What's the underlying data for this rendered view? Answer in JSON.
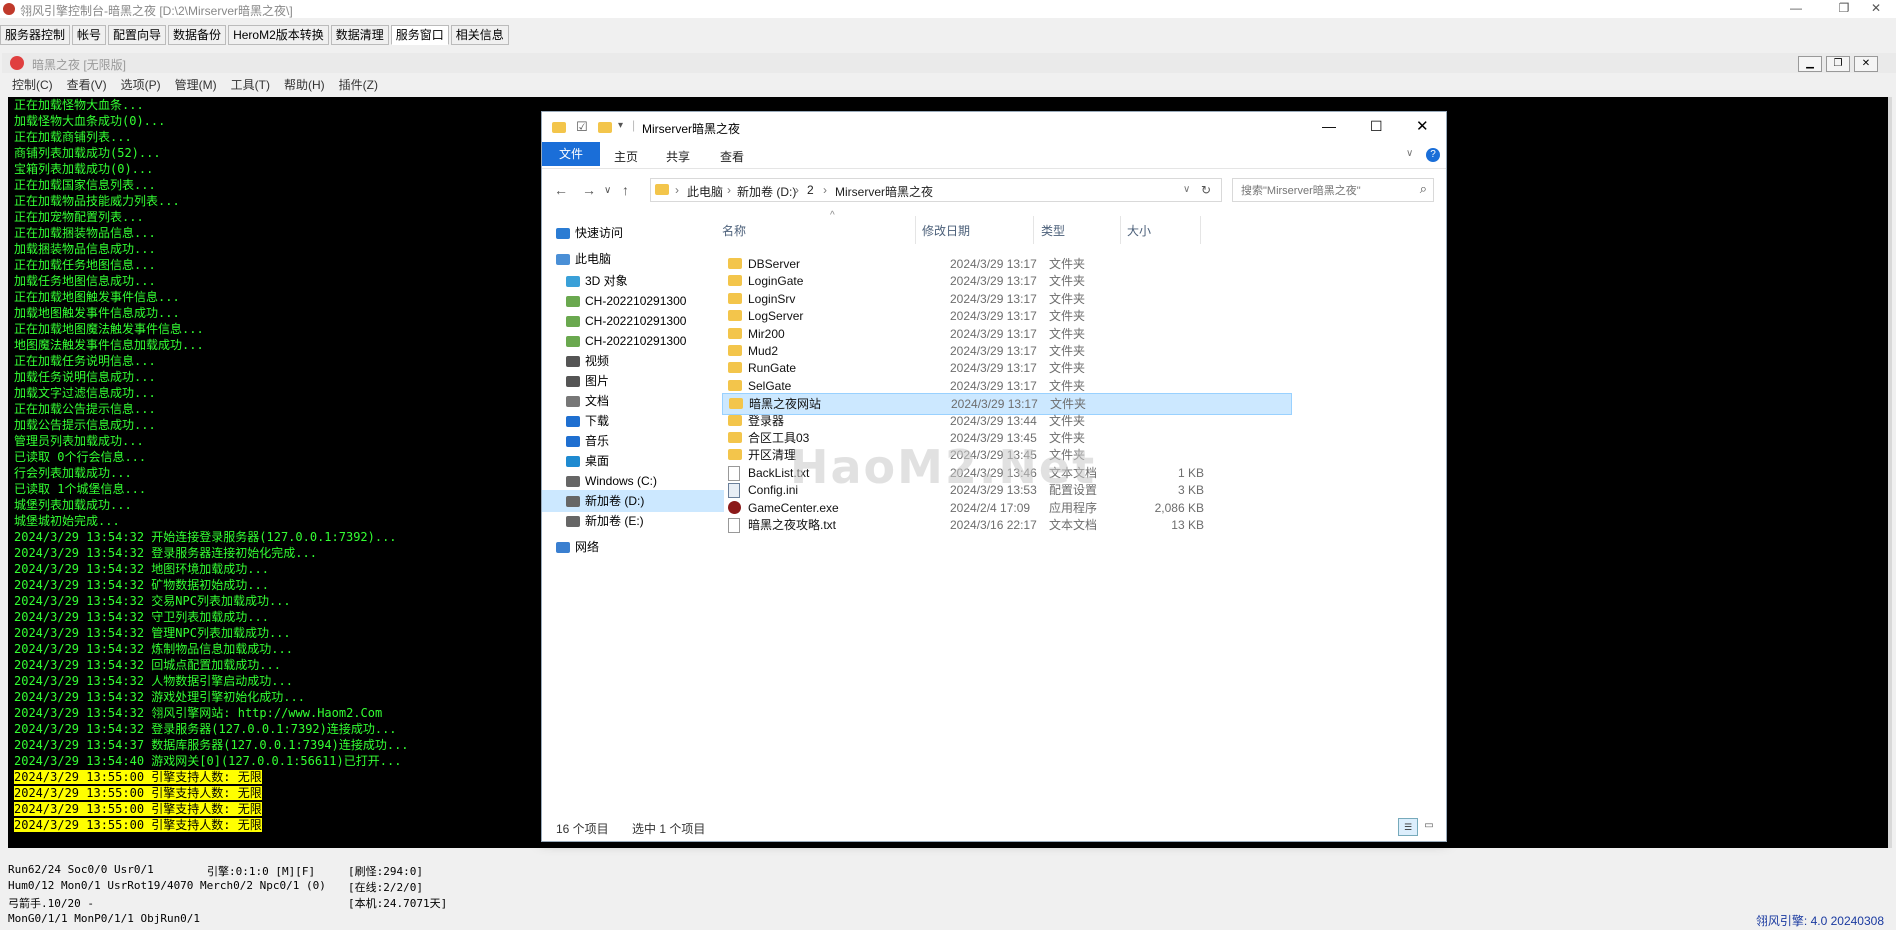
{
  "app": {
    "title": "翎风引擎控制台-暗黑之夜 [D:\\2\\Mirserver暗黑之夜\\]",
    "tabs": [
      "服务器控制",
      "帐号",
      "配置向导",
      "数据备份",
      "HeroM2版本转换",
      "数据清理",
      "服务窗口",
      "相关信息"
    ],
    "active_tab": "服务窗口"
  },
  "mdi": {
    "title": "暗黑之夜 [无限版]",
    "menu": [
      "控制(C)",
      "查看(V)",
      "选项(P)",
      "管理(M)",
      "工具(T)",
      "帮助(H)",
      "插件(Z)"
    ]
  },
  "console": {
    "lines": [
      "正在加载怪物大血条...",
      "加载怪物大血条成功(0)...",
      "正在加载商铺列表...",
      "商铺列表加载成功(52)...",
      "宝箱列表加载成功(0)...",
      "正在加载国家信息列表...",
      "正在加载物品技能威力列表...",
      "正在加宠物配置列表...",
      "正在加载捆装物品信息...",
      "加载捆装物品信息成功...",
      "正在加载任务地图信息...",
      "加载任务地图信息成功...",
      "正在加载地图触发事件信息...",
      "加载地图触发事件信息成功...",
      "正在加载地图魔法触发事件信息...",
      "地图魔法触发事件信息加载成功...",
      "正在加载任务说明信息...",
      "加载任务说明信息成功...",
      "加载文字过滤信息成功...",
      "正在加载公告提示信息...",
      "加载公告提示信息成功...",
      "管理员列表加载成功...",
      "已读取 0个行会信息...",
      "行会列表加载成功...",
      "已读取 1个城堡信息...",
      "城堡列表加载成功...",
      "城堡城初始完成...",
      "2024/3/29 13:54:32 开始连接登录服务器(127.0.0.1:7392)...",
      "2024/3/29 13:54:32 登录服务器连接初始化完成...",
      "2024/3/29 13:54:32 地图环境加载成功...",
      "2024/3/29 13:54:32 矿物数据初始成功...",
      "2024/3/29 13:54:32 交易NPC列表加载成功...",
      "2024/3/29 13:54:32 守卫列表加载成功...",
      "2024/3/29 13:54:32 管理NPC列表加载成功...",
      "2024/3/29 13:54:32 炼制物品信息加载成功...",
      "2024/3/29 13:54:32 回城点配置加载成功...",
      "2024/3/29 13:54:32 人物数据引擎启动成功...",
      "2024/3/29 13:54:32 游戏处理引擎初始化成功...",
      "2024/3/29 13:54:32 翎风引擎网站: http://www.Haom2.Com",
      "2024/3/29 13:54:32 登录服务器(127.0.0.1:7392)连接成功...",
      "2024/3/29 13:54:37 数据库服务器(127.0.0.1:7394)连接成功...",
      "2024/3/29 13:54:40 游戏网关[0](127.0.0.1:56611)已打开..."
    ],
    "highlight_lines": [
      "2024/3/29 13:55:00 引擎支持人数: 无限",
      "2024/3/29 13:55:00 引擎支持人数: 无限",
      "2024/3/29 13:55:00 引擎支持人数: 无限",
      "2024/3/29 13:55:00 引擎支持人数: 无限"
    ]
  },
  "status": {
    "col1": [
      "Run62/24 Soc0/0 Usr0/1",
      "Hum0/12 Mon0/1 UsrRot19/4070 Merch0/2 Npc0/1 (0)",
      "弓箭手.10/20 -",
      "MonG0/1/1 MonP0/1/1 ObjRun0/1"
    ],
    "engine": "引擎:0:1:0 [M][F]",
    "col3": [
      "[刷怪:294:0]",
      "[在线:2/2/0]",
      "[本机:24.7071天]"
    ],
    "version": "翎风引擎: 4.0 20240308"
  },
  "explorer": {
    "title": "Mirserver暗黑之夜",
    "ribbon": {
      "file": "文件",
      "home": "主页",
      "share": "共享",
      "view": "查看"
    },
    "breadcrumb": [
      "此电脑",
      "新加卷 (D:)",
      "2",
      "Mirserver暗黑之夜"
    ],
    "search_placeholder": "搜索\"Mirserver暗黑之夜\"",
    "nav": [
      {
        "label": "快速访问",
        "icon": "star-icon",
        "color": "#2b7cd3"
      },
      {
        "label": "此电脑",
        "icon": "computer-icon",
        "color": "#4a8fd6"
      },
      {
        "label": "3D 对象",
        "icon": "cube-icon",
        "color": "#3aa0d8"
      },
      {
        "label": "CH-202210291300",
        "icon": "network-drive-icon",
        "color": "#6aa84f"
      },
      {
        "label": "CH-202210291300",
        "icon": "network-drive-icon",
        "color": "#6aa84f"
      },
      {
        "label": "CH-202210291300",
        "icon": "network-drive-icon",
        "color": "#6aa84f"
      },
      {
        "label": "视频",
        "icon": "video-icon",
        "color": "#555555"
      },
      {
        "label": "图片",
        "icon": "pictures-icon",
        "color": "#555555"
      },
      {
        "label": "文档",
        "icon": "documents-icon",
        "color": "#777777"
      },
      {
        "label": "下载",
        "icon": "download-icon",
        "color": "#1f6fd0"
      },
      {
        "label": "音乐",
        "icon": "music-icon",
        "color": "#1f6fd0"
      },
      {
        "label": "桌面",
        "icon": "desktop-icon",
        "color": "#1f8ad0"
      },
      {
        "label": "Windows (C:)",
        "icon": "drive-icon",
        "color": "#666666"
      },
      {
        "label": "新加卷 (D:)",
        "icon": "drive-icon",
        "color": "#666666"
      },
      {
        "label": "新加卷 (E:)",
        "icon": "drive-icon",
        "color": "#666666"
      },
      {
        "label": "网络",
        "icon": "network-icon",
        "color": "#3a7fd0"
      }
    ],
    "nav_selected_index": 13,
    "columns": {
      "name": "名称",
      "date": "修改日期",
      "type": "类型",
      "size": "大小"
    },
    "files": [
      {
        "name": "DBServer",
        "date": "2024/3/29 13:17",
        "type": "文件夹",
        "size": "",
        "kind": "folder"
      },
      {
        "name": "LoginGate",
        "date": "2024/3/29 13:17",
        "type": "文件夹",
        "size": "",
        "kind": "folder"
      },
      {
        "name": "LoginSrv",
        "date": "2024/3/29 13:17",
        "type": "文件夹",
        "size": "",
        "kind": "folder"
      },
      {
        "name": "LogServer",
        "date": "2024/3/29 13:17",
        "type": "文件夹",
        "size": "",
        "kind": "folder"
      },
      {
        "name": "Mir200",
        "date": "2024/3/29 13:17",
        "type": "文件夹",
        "size": "",
        "kind": "folder"
      },
      {
        "name": "Mud2",
        "date": "2024/3/29 13:17",
        "type": "文件夹",
        "size": "",
        "kind": "folder"
      },
      {
        "name": "RunGate",
        "date": "2024/3/29 13:17",
        "type": "文件夹",
        "size": "",
        "kind": "folder"
      },
      {
        "name": "SelGate",
        "date": "2024/3/29 13:17",
        "type": "文件夹",
        "size": "",
        "kind": "folder"
      },
      {
        "name": "暗黑之夜网站",
        "date": "2024/3/29 13:17",
        "type": "文件夹",
        "size": "",
        "kind": "folder"
      },
      {
        "name": "登录器",
        "date": "2024/3/29 13:44",
        "type": "文件夹",
        "size": "",
        "kind": "folder"
      },
      {
        "name": "合区工具03",
        "date": "2024/3/29 13:45",
        "type": "文件夹",
        "size": "",
        "kind": "folder"
      },
      {
        "name": "开区清理",
        "date": "2024/3/29 13:45",
        "type": "文件夹",
        "size": "",
        "kind": "folder"
      },
      {
        "name": "BackList.txt",
        "date": "2024/3/29 13:46",
        "type": "文本文档",
        "size": "1 KB",
        "kind": "txt"
      },
      {
        "name": "Config.ini",
        "date": "2024/3/29 13:53",
        "type": "配置设置",
        "size": "3 KB",
        "kind": "ini"
      },
      {
        "name": "GameCenter.exe",
        "date": "2024/2/4 17:09",
        "type": "应用程序",
        "size": "2,086 KB",
        "kind": "exe"
      },
      {
        "name": "暗黑之夜攻略.txt",
        "date": "2024/3/16 22:17",
        "type": "文本文档",
        "size": "13 KB",
        "kind": "txt"
      }
    ],
    "selected_file_index": 8,
    "status_count": "16 个项目",
    "status_selected": "选中 1 个项目",
    "watermark": "HaoM2.Net"
  }
}
